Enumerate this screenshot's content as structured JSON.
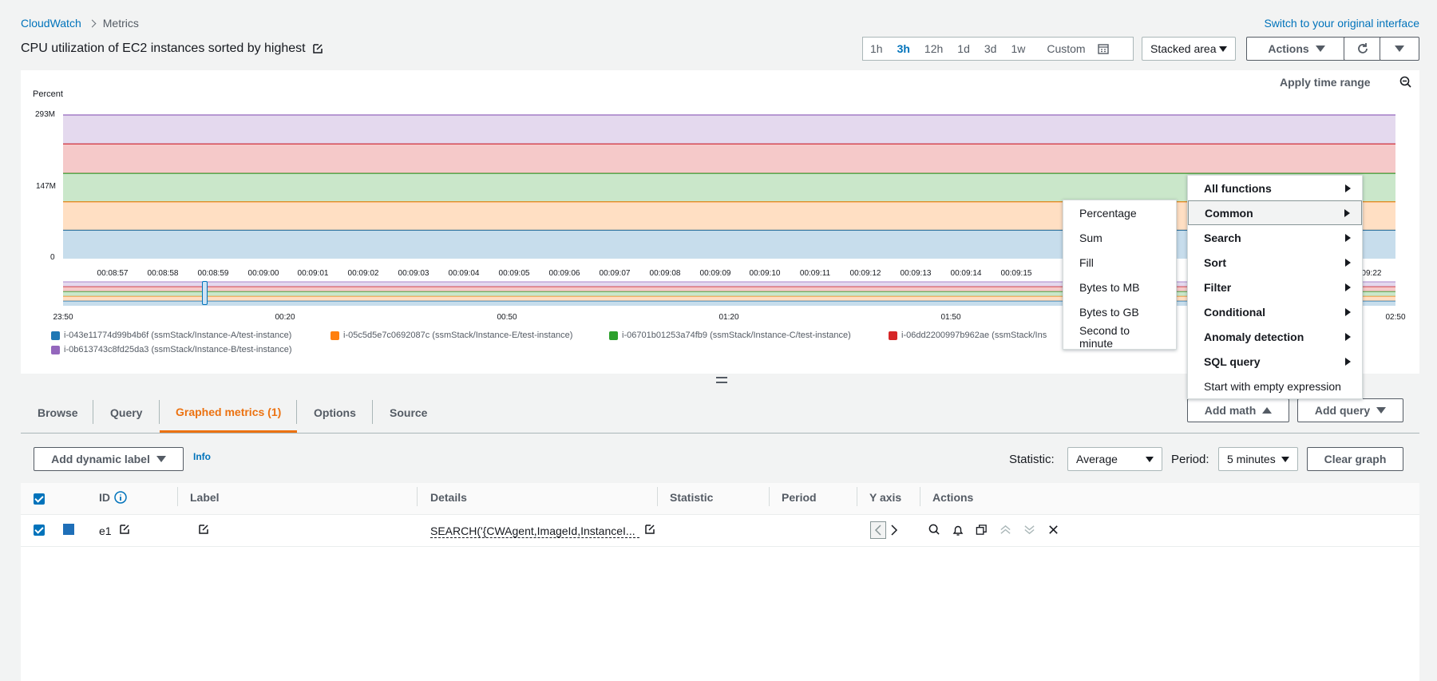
{
  "breadcrumb": {
    "root": "CloudWatch",
    "current": "Metrics"
  },
  "header": {
    "title": "CPU utilization of EC2 instances sorted by highest",
    "switch_link": "Switch to your original interface"
  },
  "time_ranges": [
    "1h",
    "3h",
    "12h",
    "1d",
    "3d",
    "1w"
  ],
  "time_selected": "3h",
  "custom_label": "Custom",
  "graph_type": "Stacked area",
  "actions_label": "Actions",
  "apply_time_range": "Apply time range",
  "chart_data": {
    "type": "area",
    "stacked": true,
    "ylabel": "Percent",
    "y_ticks": [
      "293M",
      "147M",
      "0"
    ],
    "ylim": [
      0,
      293
    ],
    "x_ticks": [
      "00:08:57",
      "00:08:58",
      "00:08:59",
      "00:09:00",
      "00:09:01",
      "00:09:02",
      "00:09:03",
      "00:09:04",
      "00:09:05",
      "00:09:06",
      "00:09:07",
      "00:09:08",
      "00:09:09",
      "00:09:10",
      "00:09:11",
      "00:09:12",
      "00:09:13",
      "00:09:14",
      "00:09:15",
      "00:09:22"
    ],
    "overview_ticks": [
      "23:50",
      "00:20",
      "00:50",
      "01:20",
      "01:50",
      "02:50"
    ],
    "series": [
      {
        "name": "i-043e11774d99b4b6f (ssmStack/Instance-A/test-instance)",
        "color": "#1f77b4",
        "value": 58
      },
      {
        "name": "i-05c5d5e7c0692087c (ssmStack/Instance-E/test-instance)",
        "color": "#ff7f0e",
        "value": 58
      },
      {
        "name": "i-06701b01253a74fb9 (ssmStack/Instance-C/test-instance)",
        "color": "#2ca02c",
        "value": 58
      },
      {
        "name": "i-06dd2200997b962ae (ssmStack/Ins",
        "color": "#d62728",
        "value": 60
      },
      {
        "name": "i-0b613743c8fd25da3 (ssmStack/Instance-B/test-instance)",
        "color": "#9467bd",
        "value": 59
      }
    ]
  },
  "math_menu": {
    "items": [
      {
        "label": "All functions",
        "submenu": true
      },
      {
        "label": "Common",
        "submenu": true,
        "active": true
      },
      {
        "label": "Search",
        "submenu": true
      },
      {
        "label": "Sort",
        "submenu": true
      },
      {
        "label": "Filter",
        "submenu": true
      },
      {
        "label": "Conditional",
        "submenu": true
      },
      {
        "label": "Anomaly detection",
        "submenu": true
      },
      {
        "label": "SQL query",
        "submenu": true
      },
      {
        "label": "Start with empty expression",
        "submenu": false
      }
    ],
    "common_submenu": [
      "Percentage",
      "Sum",
      "Fill",
      "Bytes to MB",
      "Bytes to GB",
      "Second to minute"
    ]
  },
  "tabs": [
    "Browse",
    "Query",
    "Graphed metrics (1)",
    "Options",
    "Source"
  ],
  "active_tab": "Graphed metrics (1)",
  "add_math": "Add math",
  "add_query": "Add query",
  "toolbar": {
    "dynamic_label": "Add dynamic label",
    "info": "Info",
    "statistic_label": "Statistic:",
    "statistic_value": "Average",
    "period_label": "Period:",
    "period_value": "5 minutes",
    "clear_graph": "Clear graph"
  },
  "table": {
    "headers": [
      "ID",
      "Label",
      "Details",
      "Statistic",
      "Period",
      "Y axis",
      "Actions"
    ],
    "rows": [
      {
        "id": "e1",
        "label": "",
        "details": "SEARCH('{CWAgent,ImageId,InstanceI...",
        "color": "#1f6fb8"
      }
    ]
  }
}
